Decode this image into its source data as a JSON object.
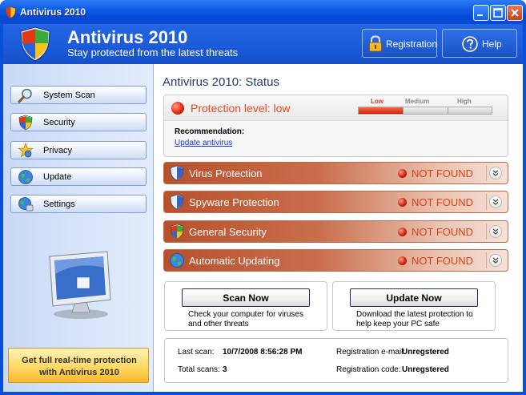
{
  "window": {
    "title": "Antivirus 2010"
  },
  "header": {
    "app_title": "Antivirus 2010",
    "tagline": "Stay protected from the latest threats",
    "registration_label": "Registration",
    "help_label": "Help"
  },
  "sidebar": {
    "items": [
      {
        "label": "System Scan",
        "icon": "magnifier-icon"
      },
      {
        "label": "Security",
        "icon": "shield-icon"
      },
      {
        "label": "Privacy",
        "icon": "privacy-icon"
      },
      {
        "label": "Update",
        "icon": "globe-icon"
      },
      {
        "label": "Settings",
        "icon": "settings-icon"
      }
    ],
    "promo": {
      "line1": "Get full real-time protection",
      "line2": "with Antivirus 2010"
    }
  },
  "status": {
    "title": "Antivirus 2010: Status",
    "protection_text": "Protection level: low",
    "meter": {
      "low": "Low",
      "medium": "Medium",
      "high": "High",
      "level": 0.34
    },
    "recommendation_title": "Recommendation:",
    "recommendation_link": "Update antivirus"
  },
  "threats": [
    {
      "name": "Virus Protection",
      "state": "NOT FOUND",
      "icon": "shield-icon"
    },
    {
      "name": "Spyware Protection",
      "state": "NOT FOUND",
      "icon": "shield-icon"
    },
    {
      "name": "General Security",
      "state": "NOT FOUND",
      "icon": "shield-icon"
    },
    {
      "name": "Automatic Updating",
      "state": "NOT FOUND",
      "icon": "globe-icon"
    }
  ],
  "actions": {
    "scan": {
      "label": "Scan Now",
      "desc1": "Check your computer for viruses",
      "desc2": "and other threats"
    },
    "update": {
      "label": "Update Now",
      "desc1": "Download the latest protection to",
      "desc2": "help keep your PC safe"
    }
  },
  "info": {
    "last_scan_label": "Last scan:",
    "last_scan_value": "10/7/2008 8:56:28 PM",
    "total_scans_label": "Total scans:",
    "total_scans_value": "3",
    "reg_email_label": "Registration e-mail:",
    "reg_email_value": "Unregstered",
    "reg_code_label": "Registration code:",
    "reg_code_value": "Unregstered"
  },
  "colors": {
    "accent": "#0a4fd8",
    "danger": "#d64215",
    "threat_bar": "#b8502c"
  }
}
